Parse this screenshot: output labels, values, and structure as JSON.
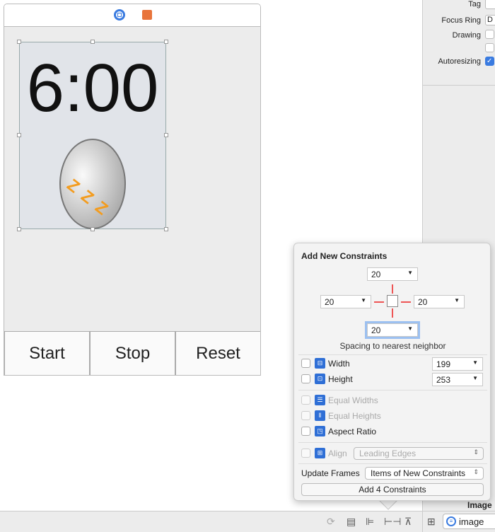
{
  "canvas": {
    "timer_text": "6:00",
    "egg_zzz": "Z Z Z",
    "buttons": [
      {
        "label": "Start"
      },
      {
        "label": "Stop"
      },
      {
        "label": "Reset"
      }
    ],
    "scene_icons": [
      "view-controller-icon",
      "first-responder-cube-icon"
    ]
  },
  "inspector": {
    "tag_label": "Tag",
    "focus_ring_label": "Focus Ring",
    "focus_ring_value": "D",
    "drawing_label": "Drawing",
    "autoresizing_label": "Autoresizing",
    "autoresizing_checked": true,
    "section_heading": "Image"
  },
  "popover": {
    "title": "Add New Constraints",
    "top": "20",
    "left": "20",
    "right": "20",
    "bottom": "20",
    "spacing_caption": "Spacing to nearest neighbor",
    "width_label": "Width",
    "width_value": "199",
    "height_label": "Height",
    "height_value": "253",
    "equal_widths": "Equal Widths",
    "equal_heights": "Equal Heights",
    "aspect_ratio": "Aspect Ratio",
    "align_label": "Align",
    "align_value": "Leading Edges",
    "update_frames_label": "Update Frames",
    "update_frames_value": "Items of New Constraints",
    "add_button": "Add 4 Constraints"
  },
  "bottombar": {
    "filter_value": "image",
    "icons": [
      "update-frames-icon",
      "embed-in-stack-icon",
      "align-icon",
      "pin-icon",
      "resolve-issues-icon",
      "outline-toggle-icon",
      "filter-icon"
    ]
  },
  "colors": {
    "accent": "#2f6fd6",
    "constraint_red": "#e55555",
    "egg_zzz": "#f39c1f"
  }
}
